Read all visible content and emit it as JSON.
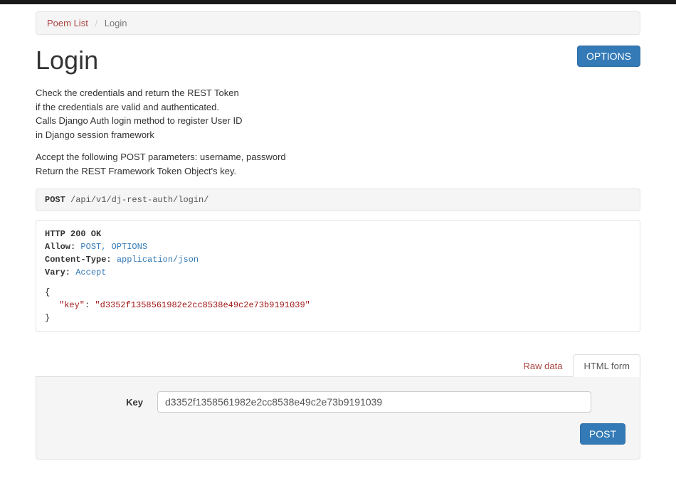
{
  "breadcrumb": {
    "root": "Poem List",
    "current": "Login"
  },
  "page": {
    "title": "Login",
    "options_label": "OPTIONS",
    "desc_line1": "Check the credentials and return the REST Token",
    "desc_line2": "if the credentials are valid and authenticated.",
    "desc_line3": "Calls Django Auth login method to register User ID",
    "desc_line4": "in Django session framework",
    "desc_line5": "Accept the following POST parameters: username, password",
    "desc_line6": "Return the REST Framework Token Object's key."
  },
  "request": {
    "method": "POST",
    "path": "/api/v1/dj-rest-auth/login/"
  },
  "response": {
    "status": "HTTP 200 OK",
    "allow_key": "Allow:",
    "allow_val": "POST, OPTIONS",
    "ctype_key": "Content-Type:",
    "ctype_val": "application/json",
    "vary_key": "Vary:",
    "vary_val": "Accept",
    "body_open": "{",
    "body_key": "\"key\"",
    "body_colon": ":",
    "body_val": "\"d3352f1358561982e2cc8538e49c2e73b9191039\"",
    "body_close": "}"
  },
  "tabs": {
    "raw": "Raw data",
    "html": "HTML form"
  },
  "form": {
    "key_label": "Key",
    "key_value": "d3352f1358561982e2cc8538e49c2e73b9191039",
    "post_label": "POST"
  }
}
